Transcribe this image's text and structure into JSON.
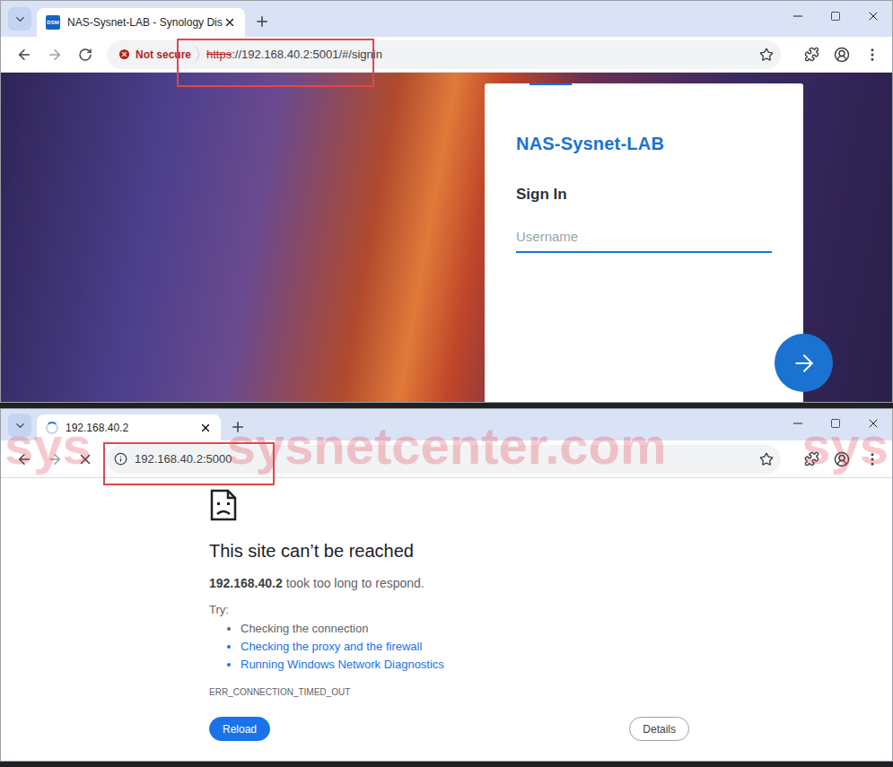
{
  "top_window": {
    "tab": {
      "title": "NAS-Sysnet-LAB - Synology Dis",
      "favicon": "DSM",
      "loading": false
    },
    "security": "Not secure",
    "url": {
      "scheme": "https",
      "rest": "://192.168.40.2:5001/#/signin"
    },
    "url_highlighted": true,
    "signin": {
      "hostname": "NAS-Sysnet-LAB",
      "heading": "Sign In",
      "username_placeholder": "Username"
    }
  },
  "bottom_window": {
    "tab": {
      "title": "192.168.40.2",
      "loading": true
    },
    "url": "192.168.40.2:5000",
    "url_highlighted": true,
    "watermark": {
      "left": "sys",
      "center": "sysnetcenter.com",
      "right": "sys"
    },
    "error": {
      "title": "This site can’t be reached",
      "host": "192.168.40.2",
      "message": " took too long to respond.",
      "try_label": "Try:",
      "suggestions": [
        {
          "text": "Checking the connection",
          "link": false
        },
        {
          "text": "Checking the proxy and the firewall",
          "link": true
        },
        {
          "text": "Running Windows Network Diagnostics",
          "link": true
        }
      ],
      "code": "ERR_CONNECTION_TIMED_OUT",
      "buttons": [
        {
          "label": "Reload",
          "primary": true
        },
        {
          "label": "Details",
          "primary": false
        }
      ]
    }
  }
}
